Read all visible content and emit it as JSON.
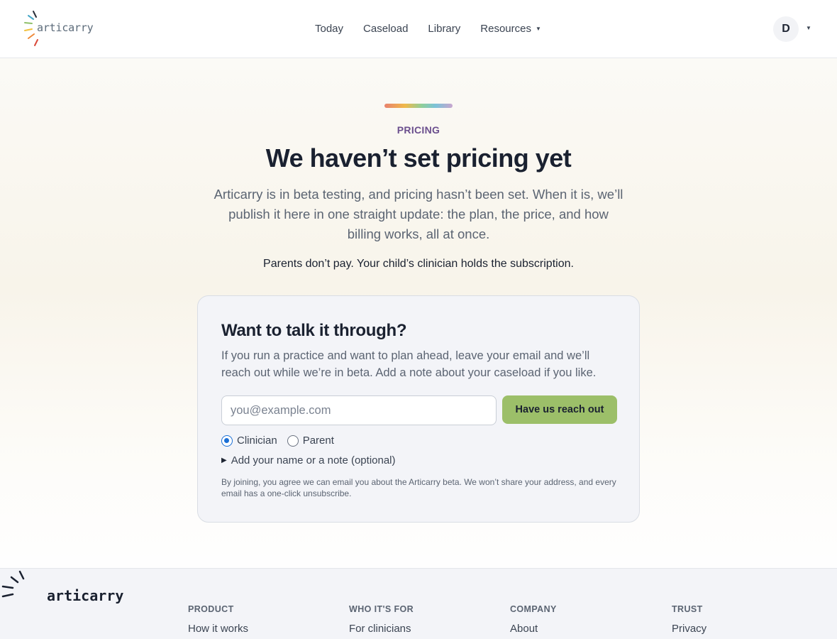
{
  "header": {
    "logo_text": "articarry",
    "nav": [
      {
        "label": "Today"
      },
      {
        "label": "Caseload"
      },
      {
        "label": "Library"
      },
      {
        "label": "Resources"
      }
    ],
    "avatar_initial": "D"
  },
  "hero": {
    "eyebrow": "PRICING",
    "title": "We haven’t set pricing yet",
    "lede": "Articarry is in beta testing, and pricing hasn’t been set. When it is, we’ll publish it here in one straight update: the plan, the price, and how billing works, all at once.",
    "parents_note": "Parents don’t pay. Your child’s clinician holds the subscription."
  },
  "contact_card": {
    "title": "Want to talk it through?",
    "description": "If you run a practice and want to plan ahead, leave your email and we’ll reach out while we’re in beta. Add a note about your caseload if you like.",
    "email_placeholder": "you@example.com",
    "email_value": "",
    "submit_label": "Have us reach out",
    "roles": [
      {
        "label": "Clinician",
        "selected": true
      },
      {
        "label": "Parent",
        "selected": false
      }
    ],
    "disclosure_label": "Add your name or a note (optional)",
    "fineprint": "By joining, you agree we can email you about the Articarry beta. We won’t share your address, and every email has a one-click unsubscribe."
  },
  "footer": {
    "logo_text": "articarry",
    "columns": [
      {
        "title": "PRODUCT",
        "first_link": "How it works"
      },
      {
        "title": "WHO IT'S FOR",
        "first_link": "For clinicians"
      },
      {
        "title": "COMPANY",
        "first_link": "About"
      },
      {
        "title": "TRUST",
        "first_link": "Privacy"
      }
    ]
  },
  "colors": {
    "accent_purple": "#6b4f8e",
    "button_green": "#9cbf69",
    "radio_blue": "#1a6fd6"
  }
}
